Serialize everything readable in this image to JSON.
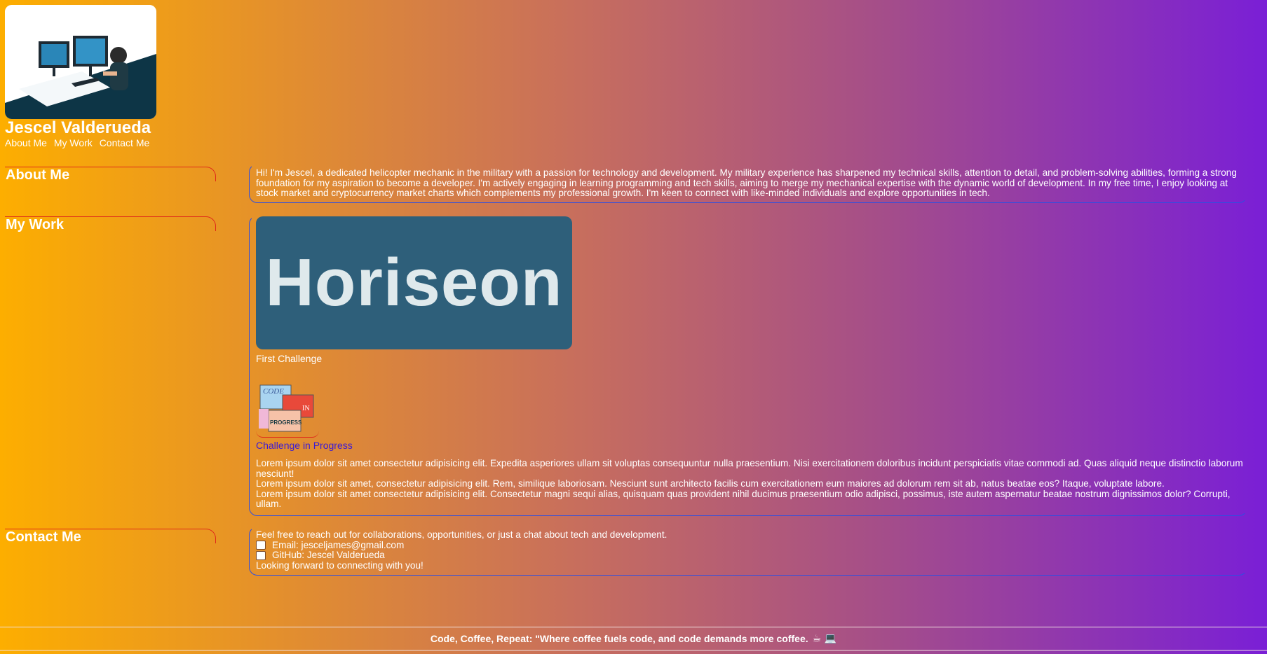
{
  "header": {
    "name": "Jescel Valderueda",
    "nav": [
      "About Me",
      "My Work",
      "Contact Me"
    ]
  },
  "about": {
    "heading": "About Me",
    "text": "Hi! I'm Jescel, a dedicated helicopter mechanic in the military with a passion for technology and development. My military experience has sharpened my technical skills, attention to detail, and problem-solving abilities, forming a strong foundation for my aspiration to become a developer. I'm actively engaging in learning programming and tech skills, aiming to merge my mechanical expertise with the dynamic world of development. In my free time, I enjoy looking at stock market and cryptocurrency market charts which complements my professional growth. I'm keen to connect with like-minded individuals and explore opportunities in tech."
  },
  "work": {
    "heading": "My Work",
    "project1_image_text": "Horiseon",
    "project1_caption": "First Challenge",
    "project2_image_text": [
      "CODE",
      "IN",
      "PROGRESS"
    ],
    "project2_link": "Challenge in Progress",
    "lorem": [
      "Lorem ipsum dolor sit amet consectetur adipisicing elit. Expedita asperiores ullam sit voluptas consequuntur nulla praesentium. Nisi exercitationem doloribus incidunt perspiciatis vitae commodi ad. Quas aliquid neque distinctio laborum nesciunt!",
      "Lorem ipsum dolor sit amet, consectetur adipisicing elit. Rem, similique laboriosam. Nesciunt sunt architecto facilis cum exercitationem eum maiores ad dolorum rem sit ab, natus beatae eos? Itaque, voluptate labore.",
      "Lorem ipsum dolor sit amet consectetur adipisicing elit. Consectetur magni sequi alias, quisquam quas provident nihil ducimus praesentium odio adipisci, possimus, iste autem aspernatur beatae nostrum dignissimos dolor? Corrupti, ullam."
    ]
  },
  "contact": {
    "heading": "Contact Me",
    "intro": "Feel free to reach out for collaborations, opportunities, or just a chat about tech and development.",
    "email": "Email: jesceljames@gmail.com",
    "github": "GitHub: Jescel Valderueda",
    "outro": "Looking forward to connecting with you!"
  },
  "footer": {
    "text": "Code, Coffee, Repeat: \"Where coffee fuels code, and code demands more coffee.",
    "emoji": "☕ 💻"
  },
  "colors": {
    "gradient_start": "#fdae00",
    "gradient_end": "#7a1fd6",
    "heading_border": "#e02a1a",
    "panel_border": "#2f4fe0",
    "link": "#3a1ad6"
  }
}
